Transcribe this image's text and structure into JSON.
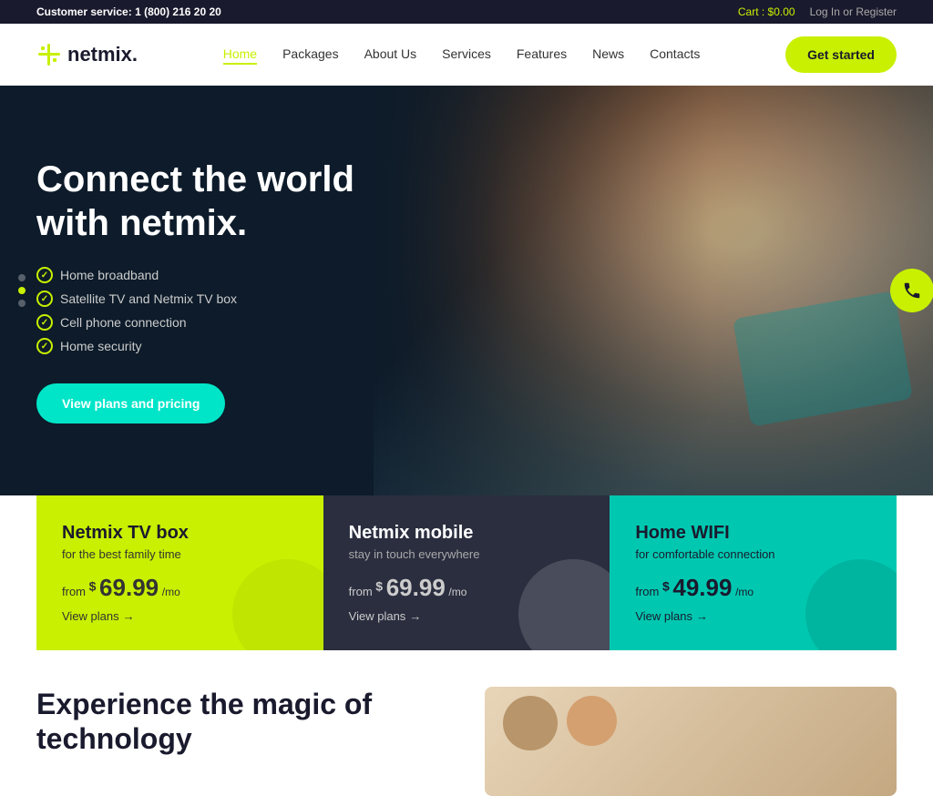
{
  "topbar": {
    "customer_service_label": "Customer service:",
    "phone": "1 (800) 216 20 20",
    "cart_label": "Cart :",
    "cart_amount": "$0.00",
    "login_label": "Log In",
    "or_text": "or",
    "register_label": "Register"
  },
  "navbar": {
    "logo_text": "netmix.",
    "nav_items": [
      {
        "label": "Home",
        "active": true
      },
      {
        "label": "Packages",
        "active": false
      },
      {
        "label": "About Us",
        "active": false
      },
      {
        "label": "Services",
        "active": false
      },
      {
        "label": "Features",
        "active": false
      },
      {
        "label": "News",
        "active": false
      },
      {
        "label": "Contacts",
        "active": false
      }
    ],
    "cta_label": "Get started"
  },
  "hero": {
    "heading": "Connect the world with netmix.",
    "features": [
      "Home broadband",
      "Satellite TV and Netmix TV box",
      "Cell phone connection",
      "Home security"
    ],
    "cta_label": "View plans and pricing",
    "dots": [
      {
        "active": false
      },
      {
        "active": true
      },
      {
        "active": false
      }
    ]
  },
  "cards": [
    {
      "id": "tv-box",
      "title": "Netmix TV box",
      "subtitle": "for the best family time",
      "price_from": "from",
      "price_sup": "$",
      "price_amount": "69.99",
      "price_per": "/mo",
      "link_label": "View plans",
      "theme": "yellow"
    },
    {
      "id": "mobile",
      "title": "Netmix mobile",
      "subtitle": "stay in touch everywhere",
      "price_from": "from",
      "price_sup": "$",
      "price_amount": "69.99",
      "price_per": "/mo",
      "link_label": "View plans",
      "theme": "dark"
    },
    {
      "id": "wifi",
      "title": "Home WIFI",
      "subtitle": "for comfortable connection",
      "price_from": "from",
      "price_sup": "$",
      "price_amount": "49.99",
      "price_per": "/mo",
      "link_label": "View plans",
      "theme": "teal"
    }
  ],
  "bottom": {
    "heading_line1": "Experience the magic of",
    "heading_line2": "technology"
  },
  "colors": {
    "accent_yellow": "#c8f000",
    "accent_teal": "#00c8b0",
    "dark_bg": "#0d1b2a",
    "card_dark": "#2a2e3f"
  }
}
